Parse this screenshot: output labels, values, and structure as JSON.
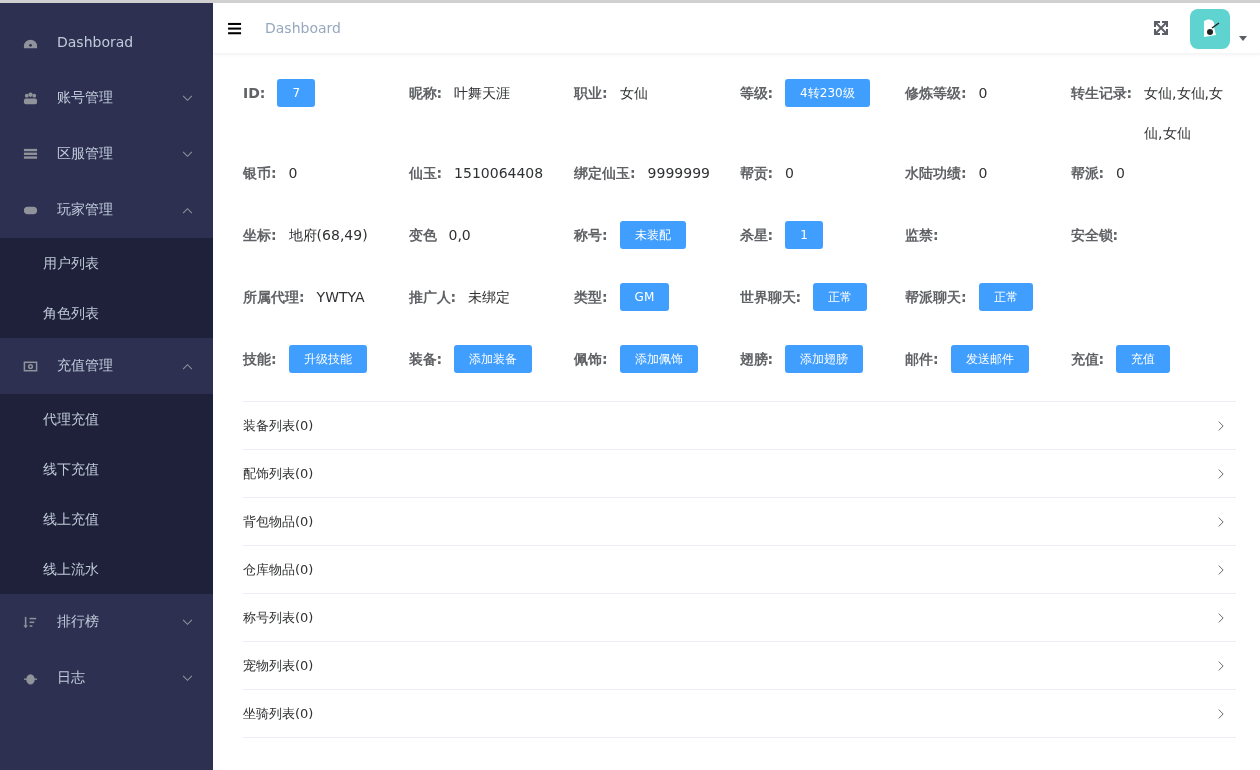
{
  "sidebar": {
    "items": [
      {
        "label": "Dashborad"
      },
      {
        "label": "账号管理",
        "expanded": false
      },
      {
        "label": "区服管理",
        "expanded": false
      },
      {
        "label": "玩家管理",
        "expanded": true,
        "children": [
          {
            "label": "用户列表"
          },
          {
            "label": "角色列表"
          }
        ]
      },
      {
        "label": "充值管理",
        "expanded": true,
        "children": [
          {
            "label": "代理充值"
          },
          {
            "label": "线下充值"
          },
          {
            "label": "线上充值"
          },
          {
            "label": "线上流水"
          }
        ]
      },
      {
        "label": "排行榜",
        "expanded": false
      },
      {
        "label": "日志",
        "expanded": false
      }
    ]
  },
  "header": {
    "breadcrumb": "Dashboard"
  },
  "fields": [
    [
      {
        "label": "ID:",
        "value": "7",
        "kind": "button"
      },
      {
        "label": "昵称:",
        "value": "叶舞天涯",
        "kind": "text"
      },
      {
        "label": "职业:",
        "value": "女仙",
        "kind": "text"
      },
      {
        "label": "等级:",
        "value": "4转230级",
        "kind": "button"
      },
      {
        "label": "修炼等级:",
        "value": "0",
        "kind": "text"
      },
      {
        "label": "转生记录:",
        "value": "女仙,女仙,女仙,女仙",
        "kind": "text"
      }
    ],
    [
      {
        "label": "银币:",
        "value": "0",
        "kind": "text"
      },
      {
        "label": "仙玉:",
        "value": "1510064408",
        "kind": "text"
      },
      {
        "label": "绑定仙玉:",
        "value": "9999999",
        "kind": "text"
      },
      {
        "label": "帮贡:",
        "value": "0",
        "kind": "text"
      },
      {
        "label": "水陆功绩:",
        "value": "0",
        "kind": "text"
      },
      {
        "label": "帮派:",
        "value": "0",
        "kind": "text"
      }
    ],
    [
      {
        "label": "坐标:",
        "value": "地府(68,49)",
        "kind": "text"
      },
      {
        "label": "变色",
        "value": "0,0",
        "kind": "text"
      },
      {
        "label": "称号:",
        "value": "未装配",
        "kind": "button"
      },
      {
        "label": "杀星:",
        "value": "1",
        "kind": "button"
      },
      {
        "label": "监禁:"
      },
      {
        "label": "安全锁:"
      }
    ],
    [
      {
        "label": "所属代理:",
        "value": "YWTYA",
        "kind": "text"
      },
      {
        "label": "推广人:",
        "value": "未绑定",
        "kind": "text"
      },
      {
        "label": "类型:",
        "value": "GM",
        "kind": "button"
      },
      {
        "label": "世界聊天:",
        "value": "正常",
        "kind": "button"
      },
      {
        "label": "帮派聊天:",
        "value": "正常",
        "kind": "button"
      }
    ],
    [
      {
        "label": "技能:",
        "value": "升级技能",
        "kind": "button"
      },
      {
        "label": "装备:",
        "value": "添加装备",
        "kind": "button"
      },
      {
        "label": "佩饰:",
        "value": "添加佩饰",
        "kind": "button"
      },
      {
        "label": "翅膀:",
        "value": "添加翅膀",
        "kind": "button"
      },
      {
        "label": "邮件:",
        "value": "发送邮件",
        "kind": "button"
      },
      {
        "label": "充值:",
        "value": "充值",
        "kind": "button"
      }
    ]
  ],
  "panels": [
    {
      "title": "装备列表(0)",
      "expanded": false
    },
    {
      "title": "配饰列表(0)",
      "expanded": false
    },
    {
      "title": "背包物品(0)",
      "expanded": false
    },
    {
      "title": "仓库物品(0)",
      "expanded": false
    },
    {
      "title": "称号列表(0)",
      "expanded": false
    },
    {
      "title": "宠物列表(0)",
      "expanded": false
    },
    {
      "title": "坐骑列表(0)",
      "expanded": false
    }
  ]
}
